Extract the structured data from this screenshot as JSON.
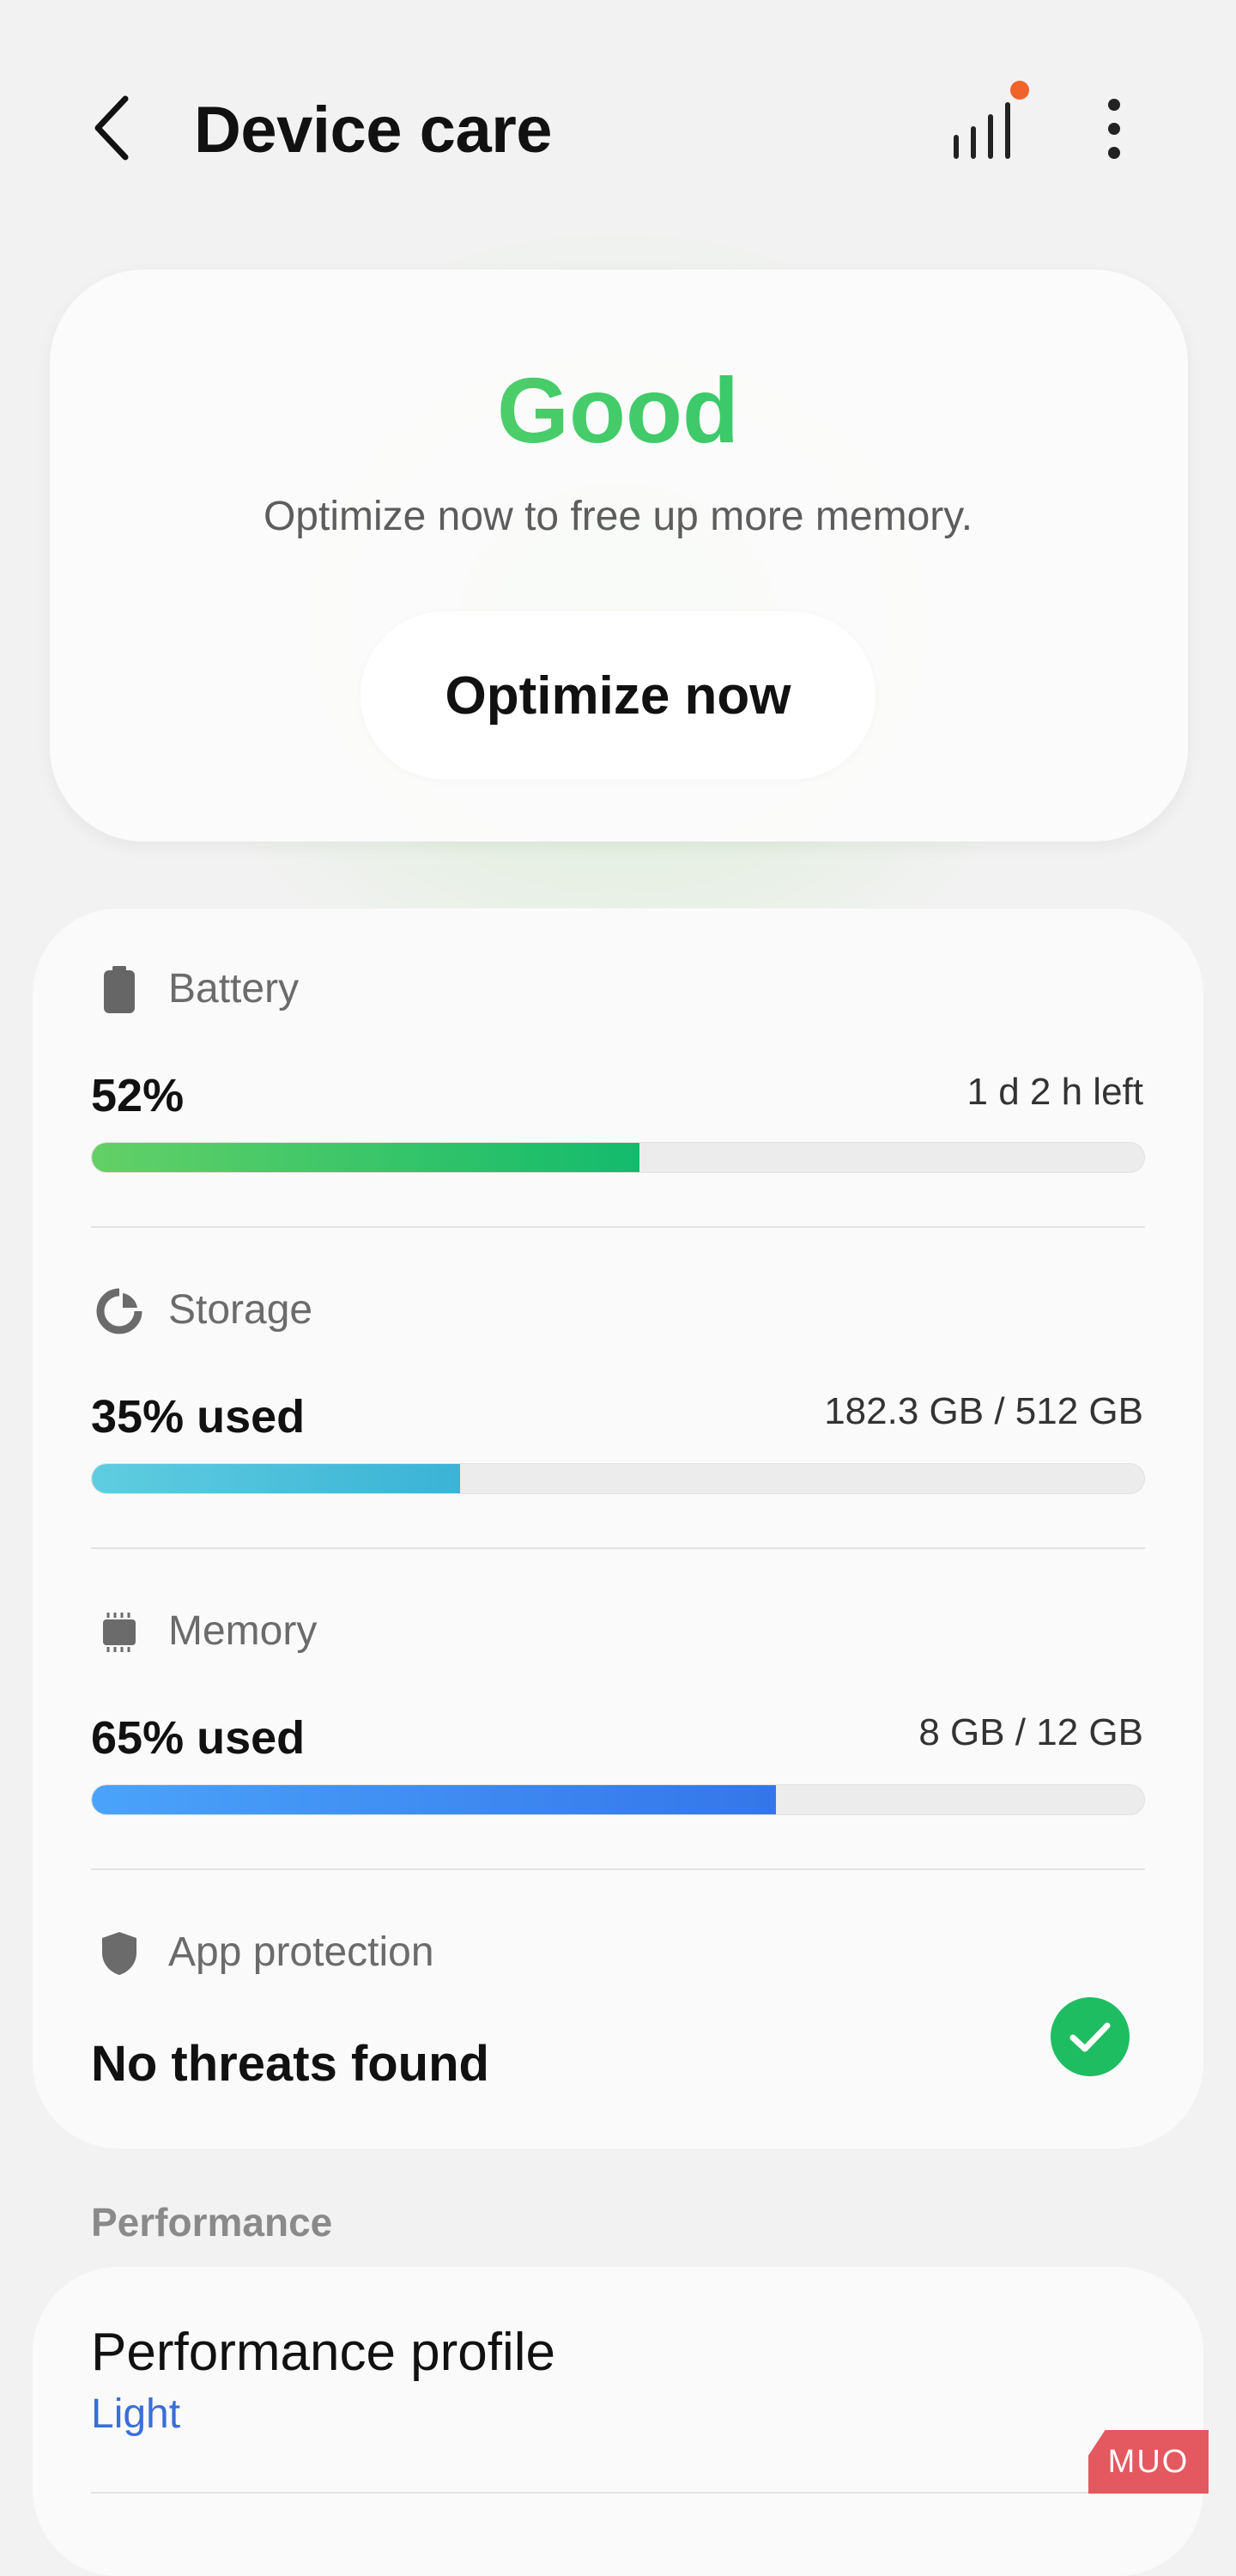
{
  "header": {
    "title": "Device care",
    "back_icon": "back-arrow-icon",
    "signal_icon": "signal-bars-icon",
    "more_icon": "more-vert-icon",
    "notification_dot_color": "#f0632a"
  },
  "status": {
    "word": "Good",
    "subtitle": "Optimize now to free up more memory.",
    "button_label": "Optimize now",
    "accent_color": "#1fbd61"
  },
  "battery": {
    "icon": "battery-icon",
    "label": "Battery",
    "value": "52%",
    "detail": "1 d 2 h left",
    "level_percent": 52,
    "color_start": "#63d066",
    "color_end": "#12bb6c"
  },
  "storage": {
    "icon": "storage-pie-icon",
    "label": "Storage",
    "value": "35% used",
    "detail": "182.3 GB / 512 GB",
    "level_percent": 35,
    "color_start": "#5fcde0",
    "color_end": "#3ab3d6"
  },
  "memory": {
    "icon": "memory-chip-icon",
    "label": "Memory",
    "value": "65% used",
    "detail": "8 GB / 12 GB",
    "level_percent": 65,
    "color_start": "#4aa3fa",
    "color_end": "#3476ea"
  },
  "protection": {
    "icon": "shield-icon",
    "label": "App protection",
    "status": "No threats found",
    "status_icon": "check-circle-icon"
  },
  "performance": {
    "section_label": "Performance",
    "profile_title": "Performance profile",
    "profile_value": "Light"
  },
  "watermark": "MUO"
}
